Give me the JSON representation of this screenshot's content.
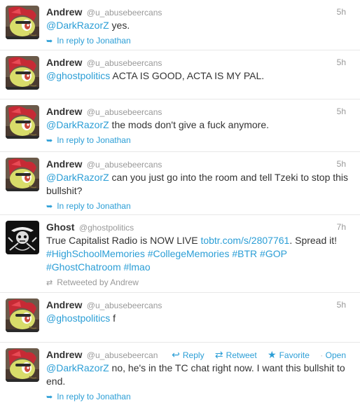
{
  "tweets": [
    {
      "fullname": "Andrew",
      "handle": "@u_abusebeercans",
      "time": "5h",
      "mention": "@DarkRazorZ",
      "text": " yes.",
      "context": "In reply to Jonathan"
    },
    {
      "fullname": "Andrew",
      "handle": "@u_abusebeercans",
      "time": "5h",
      "mention": "@ghostpolitics",
      "text": " ACTA IS GOOD, ACTA IS MY PAL."
    },
    {
      "fullname": "Andrew",
      "handle": "@u_abusebeercans",
      "time": "5h",
      "mention": "@DarkRazorZ",
      "text": " the mods don't give a fuck anymore.",
      "context": "In reply to Jonathan"
    },
    {
      "fullname": "Andrew",
      "handle": "@u_abusebeercans",
      "time": "5h",
      "mention": "@DarkRazorZ",
      "text": " can you just go into the room and tell Tzeki to stop this bullshit?",
      "context": "In reply to Jonathan"
    },
    {
      "fullname": "Ghost",
      "handle": "@ghostpolitics",
      "time": "7h",
      "text_pre": "True Capitalist Radio is NOW LIVE ",
      "url": "tobtr.com/s/2807761",
      "text_post": ". Spread it!",
      "hashtags": [
        "#HighSchoolMemories",
        "#CollegeMemories",
        "#BTR",
        "#GOP",
        "#GhostChatroom",
        "#lmao"
      ],
      "context": "Retweeted by Andrew"
    },
    {
      "fullname": "Andrew",
      "handle": "@u_abusebeercans",
      "time": "5h",
      "mention": "@ghostpolitics",
      "text": " f"
    },
    {
      "fullname": "Andrew",
      "handle": "@u_abusebeercans",
      "mention": "@DarkRazorZ",
      "text": " no, he's in the TC chat right now. I want this bullshit to end.",
      "context": "In reply to Jonathan",
      "actions": {
        "reply": "Reply",
        "retweet": "Retweet",
        "favorite": "Favorite",
        "open": "Open"
      }
    }
  ],
  "icons": {
    "reply": "reply-arrow-icon",
    "retweet": "retweet-icon",
    "favorite": "star-icon"
  },
  "colors": {
    "link": "#2b9ed6",
    "muted": "#999999",
    "text": "#333333"
  }
}
